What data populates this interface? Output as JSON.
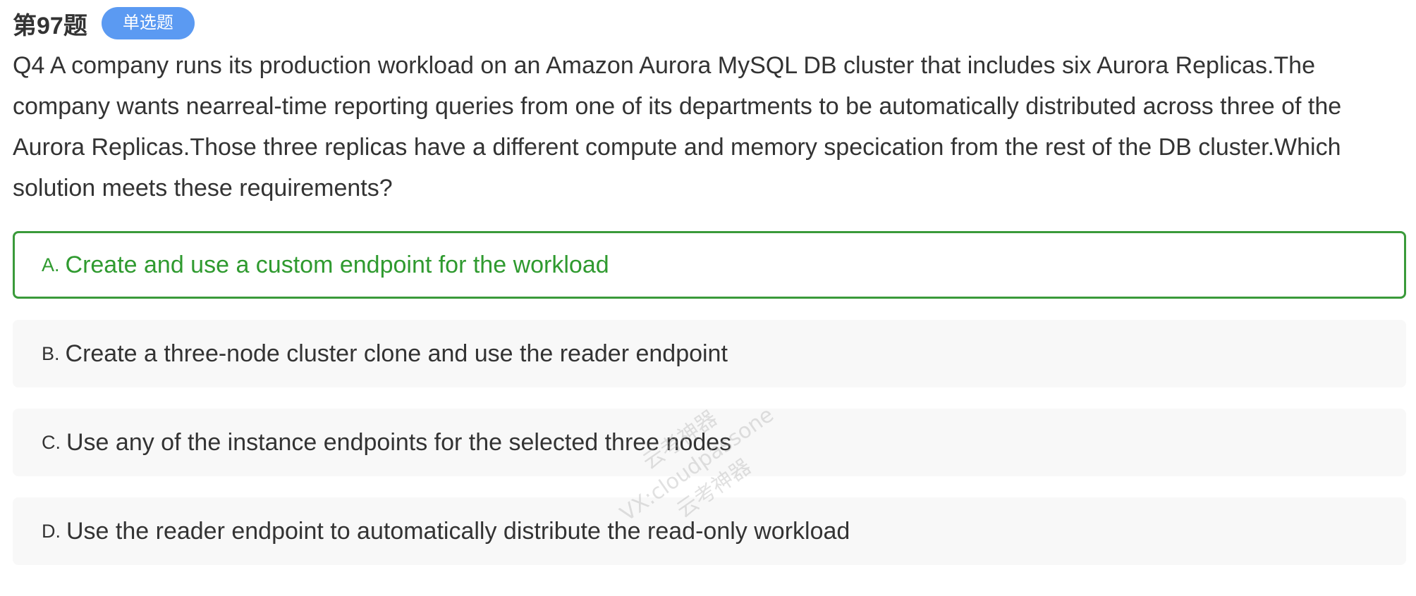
{
  "header": {
    "question_number": "第97题",
    "question_type": "单选题"
  },
  "question": {
    "text": "Q4 A company runs its production workload on an Amazon Aurora MySQL DB cluster that includes six Aurora Replicas.The company wants nearreal-time reporting queries from one of its departments to be automatically distributed across three of the Aurora Replicas.Those three replicas have a different compute and memory specication from the rest of the DB cluster.Which solution meets these requirements?"
  },
  "options": [
    {
      "letter": "A.",
      "text": "Create and use a custom endpoint for the workload",
      "state": "correct"
    },
    {
      "letter": "B.",
      "text": "Create a three-node cluster clone and use the reader endpoint",
      "state": "default"
    },
    {
      "letter": "C.",
      "text": "Use any of the instance endpoints for the selected three nodes",
      "state": "default"
    },
    {
      "letter": "D.",
      "text": "Use the reader endpoint to automatically distribute the read-only workload",
      "state": "default"
    }
  ],
  "watermark": {
    "line1": "云考神器",
    "line2": "VX:cloudpassone",
    "line3": "云考神器"
  },
  "colors": {
    "badge_bg": "#5b9af2",
    "correct_border": "#3a9a3a",
    "correct_text": "#2f9a2f",
    "option_bg": "#f8f8f8",
    "text": "#333333"
  }
}
